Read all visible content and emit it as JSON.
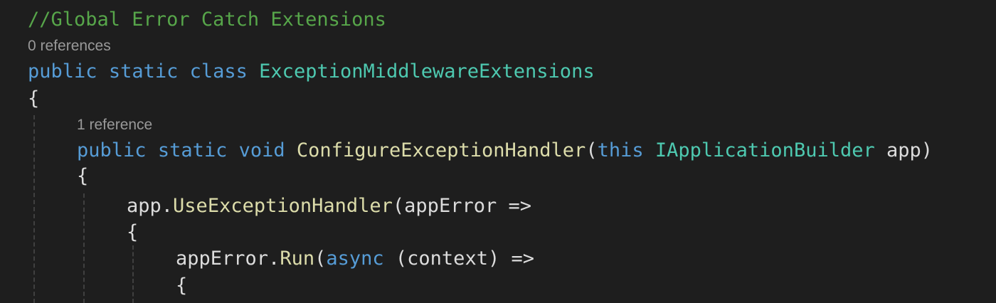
{
  "editor": {
    "theme_colors": {
      "background": "#1e1e1e",
      "comment": "#57a64a",
      "keyword": "#569cd6",
      "type": "#4ec9b0",
      "method": "#dcdcaa",
      "text": "#dcdcdc",
      "codelens": "#999999"
    },
    "lines": {
      "comment": "//Global Error Catch Extensions",
      "class_kw1": "public",
      "class_kw2": "static",
      "class_kw3": "class",
      "class_name": "ExceptionMiddlewareExtensions",
      "brace_open_1": "{",
      "method_kw1": "public",
      "method_kw2": "static",
      "method_kw3": "void",
      "method_name": "ConfigureExceptionHandler",
      "method_paren_open": "(",
      "method_this": "this",
      "method_param_type": "IApplicationBuilder",
      "method_param_name": "app",
      "method_paren_close": ")",
      "brace_open_2": "{",
      "call1_target": "app",
      "call1_dot": ".",
      "call1_method": "UseExceptionHandler",
      "call1_paren": "(",
      "call1_arg": "appError",
      "call1_arrow": "=>",
      "brace_open_3": "{",
      "call2_target": "appError",
      "call2_dot": ".",
      "call2_method": "Run",
      "call2_paren": "(",
      "call2_async": "async",
      "call2_args": "(context)",
      "call2_arrow": "=>",
      "brace_open_4": "{"
    },
    "codelens": {
      "class_refs": "0 references",
      "method_refs": "1 reference"
    }
  }
}
